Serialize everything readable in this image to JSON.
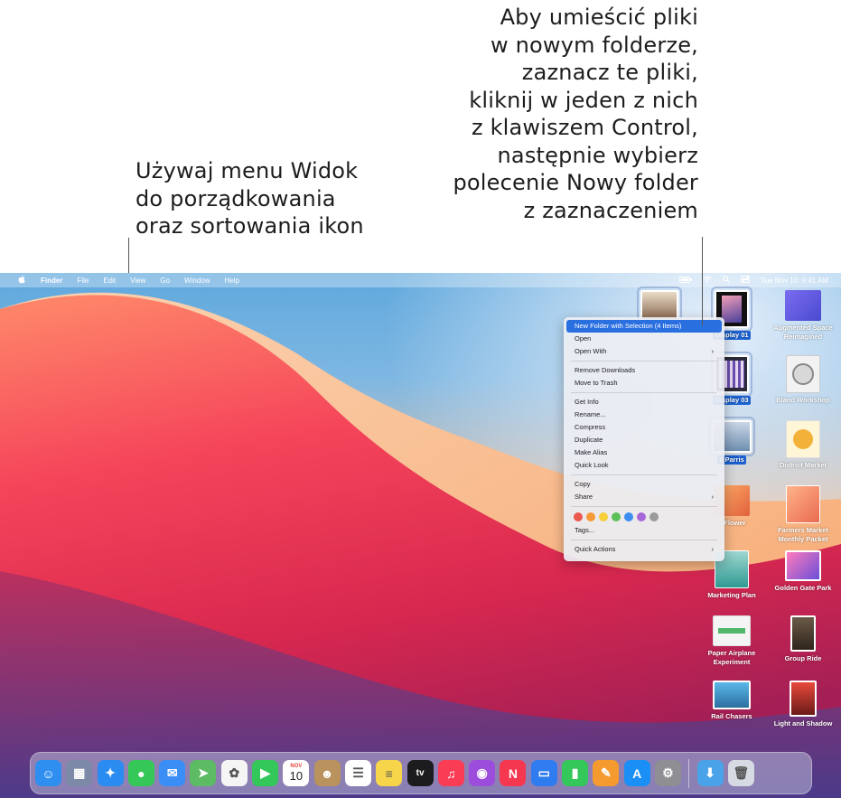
{
  "callouts": {
    "left": [
      "Używaj menu Widok",
      "do porządkowania",
      "oraz sortowania ikon"
    ],
    "right": [
      "Aby umieścić pliki",
      "w nowym folderze,",
      "zaznacz te pliki,",
      "kliknij w jeden z nich",
      "z klawiszem Control,",
      "następnie wybierz",
      "polecenie Nowy folder",
      "z zaznaczeniem"
    ]
  },
  "menubar": {
    "apple_icon": "apple-logo",
    "items": [
      "Finder",
      "File",
      "Edit",
      "View",
      "Go",
      "Window",
      "Help"
    ],
    "status_icons": [
      "battery-icon",
      "wifi-icon",
      "search-icon",
      "control-center-icon"
    ],
    "date": "Tue Nov 10",
    "time": "9:41 AM"
  },
  "desktop_icons": [
    {
      "label": "",
      "selected": true
    },
    {
      "label": "Display 01",
      "selected": true
    },
    {
      "label": "Augmented Space Reimagined",
      "selected": false
    },
    {
      "label": "Display 03",
      "selected": true
    },
    {
      "label": "Bland Workshop",
      "selected": false
    },
    {
      "label": "a Parris",
      "selected": true
    },
    {
      "label": "District Market",
      "selected": false
    },
    {
      "label": "o Flower",
      "selected": false
    },
    {
      "label": "Farmers Market Monthly Packet",
      "selected": false
    },
    {
      "label": "Marketing Plan",
      "selected": false
    },
    {
      "label": "Golden Gate Park",
      "selected": false
    },
    {
      "label": "Paper Airplane Experiment",
      "selected": false
    },
    {
      "label": "Group Ride",
      "selected": false
    },
    {
      "label": "Rail Chasers",
      "selected": false
    },
    {
      "label": "Light and Shadow",
      "selected": false
    }
  ],
  "context_menu": {
    "items": [
      {
        "label": "New Folder with Selection (4 Items)",
        "highlighted": true
      },
      {
        "label": "Open"
      },
      {
        "label": "Open With",
        "submenu": true
      },
      {
        "label": "Remove Downloads"
      },
      {
        "label": "Move to Trash"
      },
      {
        "label": "Get Info"
      },
      {
        "label": "Rename..."
      },
      {
        "label": "Compress"
      },
      {
        "label": "Duplicate"
      },
      {
        "label": "Make Alias"
      },
      {
        "label": "Quick Look"
      },
      {
        "label": "Copy"
      },
      {
        "label": "Share",
        "submenu": true
      },
      {
        "label": "Tags..."
      },
      {
        "label": "Quick Actions",
        "submenu": true
      }
    ],
    "tag_colors": [
      "#ec5a4f",
      "#f59a36",
      "#f7cf3b",
      "#5bc05a",
      "#3d8ef0",
      "#a867d6",
      "#9a9a9a"
    ],
    "submenu_glyph": "›"
  },
  "dock": {
    "apps": [
      {
        "name": "finder-icon",
        "color": "#2f8ff0",
        "glyph": "☺"
      },
      {
        "name": "launchpad-icon",
        "color": "#7c8aa8",
        "glyph": "▦"
      },
      {
        "name": "safari-icon",
        "color": "#2a8cf0",
        "glyph": "✦"
      },
      {
        "name": "messages-icon",
        "color": "#36c759",
        "glyph": "●"
      },
      {
        "name": "mail-icon",
        "color": "#3a8ef5",
        "glyph": "✉"
      },
      {
        "name": "maps-icon",
        "color": "#5dbb63",
        "glyph": "➤"
      },
      {
        "name": "photos-icon",
        "color": "#f5f5f5",
        "glyph": "✿"
      },
      {
        "name": "facetime-icon",
        "color": "#34c759",
        "glyph": "▶"
      },
      {
        "name": "calendar-icon",
        "color": "#ffffff",
        "glyph": ""
      },
      {
        "name": "contacts-icon",
        "color": "#b9925e",
        "glyph": "☻"
      },
      {
        "name": "reminders-icon",
        "color": "#ffffff",
        "glyph": "☰"
      },
      {
        "name": "notes-icon",
        "color": "#f7d54a",
        "glyph": "≡"
      },
      {
        "name": "tv-icon",
        "color": "#1c1c1e",
        "glyph": ""
      },
      {
        "name": "music-icon",
        "color": "#fa3c55",
        "glyph": "♫"
      },
      {
        "name": "podcasts-icon",
        "color": "#9c4ddb",
        "glyph": "◉"
      },
      {
        "name": "news-icon",
        "color": "#f5374f",
        "glyph": "N"
      },
      {
        "name": "keynote-icon",
        "color": "#2f7cf0",
        "glyph": "▭"
      },
      {
        "name": "numbers-icon",
        "color": "#34c759",
        "glyph": "▮"
      },
      {
        "name": "pages-icon",
        "color": "#f59a2e",
        "glyph": "✎"
      },
      {
        "name": "app-store-icon",
        "color": "#1a8ff5",
        "glyph": "A"
      },
      {
        "name": "system-preferences-icon",
        "color": "#8e8e93",
        "glyph": "⚙"
      },
      {
        "name": "downloads-folder-icon",
        "color": "#4aa3e8",
        "glyph": "⬇"
      },
      {
        "name": "trash-icon",
        "color": "#d6dbe3",
        "glyph": "🗑"
      }
    ],
    "calendar_month": "NOV",
    "calendar_day": "10",
    "tv_label": "tv"
  }
}
